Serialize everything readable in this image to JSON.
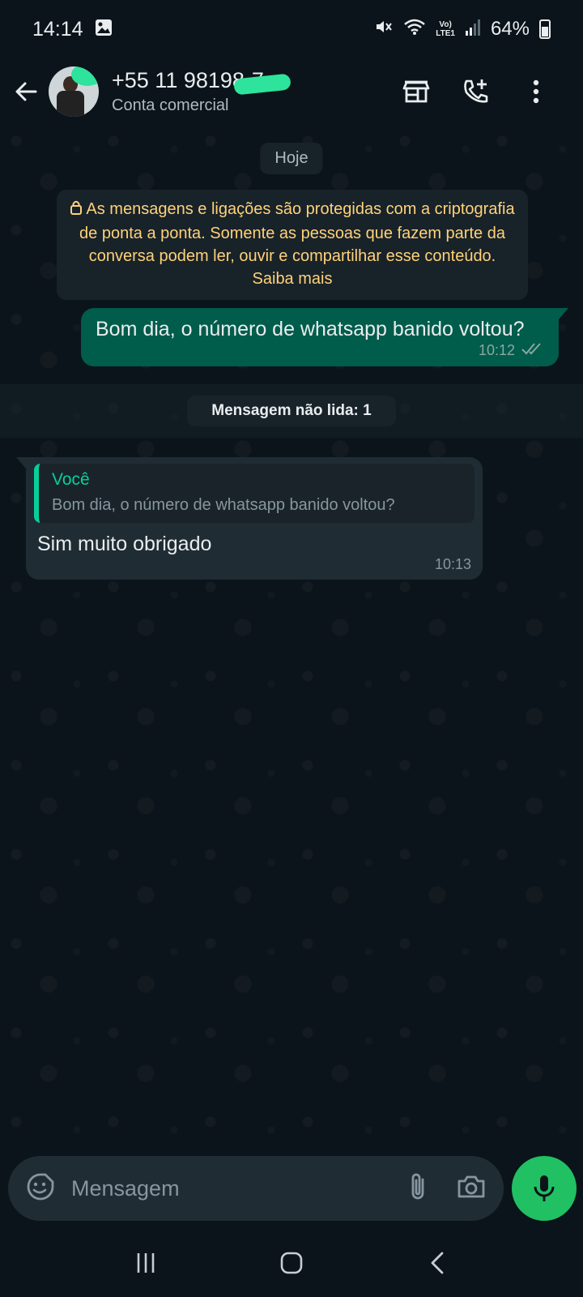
{
  "status_bar": {
    "time": "14:14",
    "network": "Vo)\nLTE1",
    "network_line1": "Vo)",
    "network_line2": "LTE1",
    "battery": "64%"
  },
  "header": {
    "contact_name": "+55 11 98198-7…",
    "contact_subtitle": "Conta comercial"
  },
  "chat": {
    "date_chip": "Hoje",
    "encryption_notice": "As mensagens e ligações são protegidas com a criptografia de ponta a ponta. Somente as pessoas que fazem parte da conversa podem ler, ouvir e compartilhar esse conteúdo. Saiba mais",
    "messages": [
      {
        "direction": "out",
        "text": "Bom dia, o número de whatsapp banido voltou?",
        "time": "10:12",
        "status": "read"
      },
      {
        "direction": "in",
        "quote_author": "Você",
        "quote_text": "Bom dia, o número de whatsapp banido voltou?",
        "text": "Sim muito obrigado",
        "time": "10:13"
      }
    ],
    "unread_banner": "Mensagem não lida: 1"
  },
  "composer": {
    "placeholder": "Mensagem"
  },
  "colors": {
    "background": "#0b141a",
    "outgoing_bubble": "#005c4b",
    "incoming_bubble": "#202c33",
    "accent_green": "#21c063",
    "notice_text": "#ffd279"
  },
  "icons": [
    "back-arrow-icon",
    "shop-icon",
    "add-call-icon",
    "more-vert-icon",
    "lock-icon",
    "double-check-icon",
    "emoji-icon",
    "attach-icon",
    "camera-icon",
    "mic-icon",
    "recents-icon",
    "home-icon",
    "back-nav-icon"
  ]
}
